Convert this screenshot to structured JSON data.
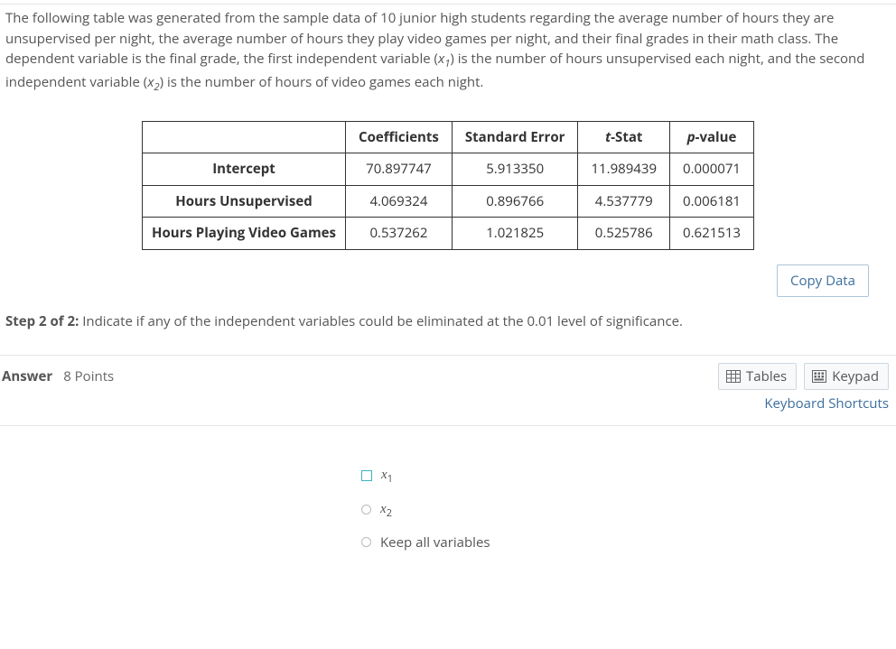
{
  "problem": {
    "text": "The following table was generated from the sample data of 10 junior high students regarding the average number of hours they are unsupervised per night, the average number of hours they play video games per night, and their final grades in their math class. The dependent variable is the final grade, the first independent variable (x1) is the number of hours unsupervised each night, and the second independent variable (x2) is the number of hours of video games each night."
  },
  "table": {
    "columns": [
      "Coefficients",
      "Standard Error",
      "t-Stat",
      "p-value"
    ],
    "rows": [
      {
        "label": "Intercept",
        "values": [
          "70.897747",
          "5.913350",
          "11.989439",
          "0.000071"
        ]
      },
      {
        "label": "Hours Unsupervised",
        "values": [
          "4.069324",
          "0.896766",
          "4.537779",
          "0.006181"
        ]
      },
      {
        "label": "Hours Playing Video Games",
        "values": [
          "0.537262",
          "1.021825",
          "0.525786",
          "0.621513"
        ]
      }
    ]
  },
  "buttons": {
    "copy_data": "Copy Data",
    "tables": "Tables",
    "keypad": "Keypad"
  },
  "step": {
    "prefix": "Step 2 of 2:",
    "text": " Indicate if any of the independent variables could be eliminated at the 0.01 level of significance."
  },
  "answer": {
    "label": "Answer",
    "points": "8 Points",
    "shortcut_link": "Keyboard Shortcuts"
  },
  "options": {
    "x1_label": "x1",
    "x2_label": "x2",
    "keep_label": "Keep all variables"
  },
  "chart_data": {
    "type": "table",
    "title": "Regression output",
    "columns": [
      "",
      "Coefficients",
      "Standard Error",
      "t-Stat",
      "p-value"
    ],
    "rows": [
      [
        "Intercept",
        70.897747,
        5.91335,
        11.989439,
        7.1e-05
      ],
      [
        "Hours Unsupervised",
        4.069324,
        0.896766,
        4.537779,
        0.006181
      ],
      [
        "Hours Playing Video Games",
        0.537262,
        1.021825,
        0.525786,
        0.621513
      ]
    ]
  }
}
